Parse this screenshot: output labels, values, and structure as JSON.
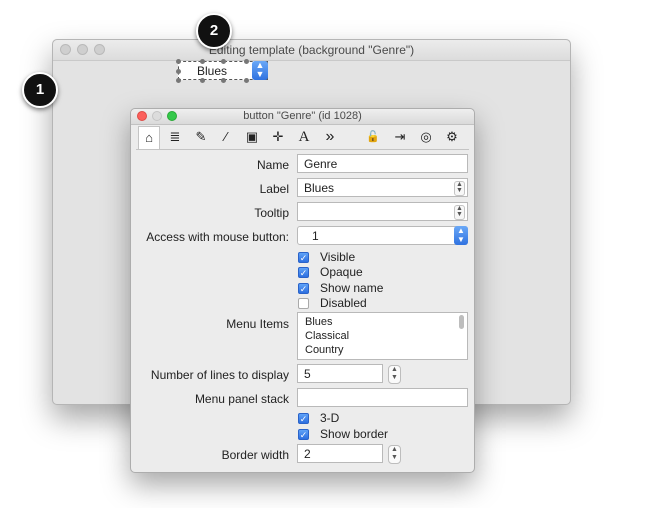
{
  "template_window": {
    "title": "Editing template (background \"Genre\")"
  },
  "popup_widget": {
    "value": "Blues"
  },
  "callouts": [
    "1",
    "2"
  ],
  "inspector": {
    "title": "button \"Genre\" (id 1028)",
    "toolbar": [
      {
        "icon": "home-icon",
        "glyph": "⌂"
      },
      {
        "icon": "database-icon",
        "glyph": "≣"
      },
      {
        "icon": "pencil-icon",
        "glyph": "✎"
      },
      {
        "icon": "wand-icon",
        "glyph": "⁄"
      },
      {
        "icon": "image-icon",
        "glyph": "▣"
      },
      {
        "icon": "move-icon",
        "glyph": "✛"
      },
      {
        "icon": "text-icon",
        "glyph": "A"
      },
      {
        "icon": "chevrons-icon",
        "glyph": "»"
      },
      {
        "icon": "lock-icon",
        "glyph": "🔓"
      },
      {
        "icon": "export-icon",
        "glyph": "⇥"
      },
      {
        "icon": "target-icon",
        "glyph": "◎"
      },
      {
        "icon": "gear-icon",
        "glyph": "⚙"
      }
    ],
    "name_label": "Name",
    "name_value": "Genre",
    "label_label": "Label",
    "label_value": "Blues",
    "tooltip_label": "Tooltip",
    "tooltip_value": "",
    "mouse_label": "Access with mouse button:",
    "mouse_value": "1",
    "checkboxes_top": [
      {
        "label": "Visible",
        "checked": true
      },
      {
        "label": "Opaque",
        "checked": true
      },
      {
        "label": "Show name",
        "checked": true
      },
      {
        "label": "Disabled",
        "checked": false
      }
    ],
    "menu_items_label": "Menu Items",
    "menu_items": [
      "Blues",
      "Classical",
      "Country"
    ],
    "lines_label": "Number of lines to display",
    "lines_value": "5",
    "menu_stack_label": "Menu panel stack",
    "menu_stack_value": "",
    "checkboxes_bottom": [
      {
        "label": "3-D",
        "checked": true
      },
      {
        "label": "Show border",
        "checked": true
      }
    ],
    "border_width_label": "Border width",
    "border_width_value": "2"
  },
  "colors": {
    "accent": "#2f72e0",
    "window_bg": "#ececec"
  }
}
